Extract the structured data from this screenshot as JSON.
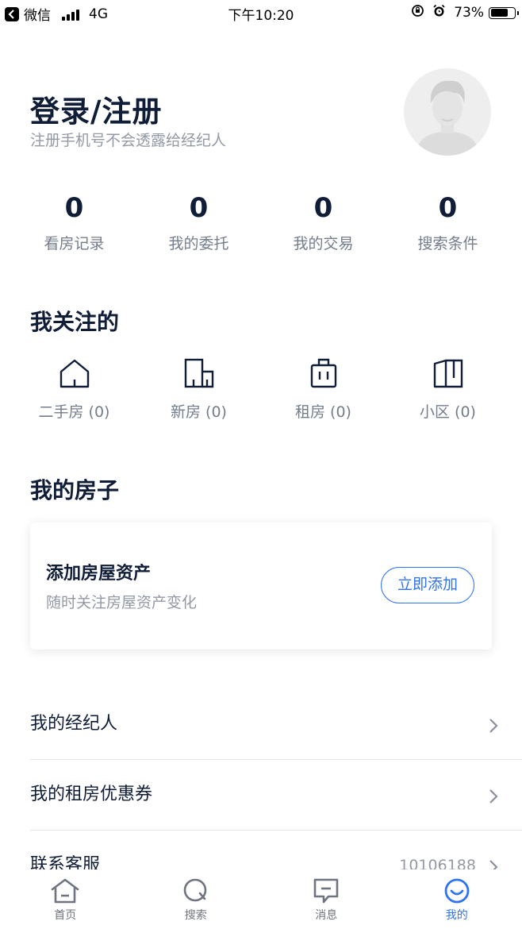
{
  "status_bar": {
    "back_app": "微信",
    "network": "4G",
    "time": "下午10:20",
    "battery": "73%",
    "battery_level": 0.73
  },
  "header": {
    "title": "登录/注册",
    "subtitle": "注册手机号不会透露给经纪人"
  },
  "stats": [
    {
      "value": "0",
      "label": "看房记录"
    },
    {
      "value": "0",
      "label": "我的委托"
    },
    {
      "value": "0",
      "label": "我的交易"
    },
    {
      "value": "0",
      "label": "搜索条件"
    }
  ],
  "follow_section": {
    "title": "我关注的",
    "items": [
      {
        "label": "二手房 (0)",
        "icon": "house-icon"
      },
      {
        "label": "新房 (0)",
        "icon": "building-icon"
      },
      {
        "label": "租房 (0)",
        "icon": "suitcase-icon"
      },
      {
        "label": "小区 (0)",
        "icon": "community-icon"
      }
    ]
  },
  "my_house": {
    "title": "我的房子",
    "card_title": "添加房屋资产",
    "card_subtitle": "随时关注房屋资产变化",
    "button": "立即添加"
  },
  "list": [
    {
      "label": "我的经纪人",
      "value": ""
    },
    {
      "label": "我的租房优惠券",
      "value": ""
    },
    {
      "label": "联系客服",
      "value": "10106188"
    }
  ],
  "tabs": [
    {
      "label": "首页",
      "icon": "home-icon",
      "active": false
    },
    {
      "label": "搜索",
      "icon": "search-icon",
      "active": false
    },
    {
      "label": "消息",
      "icon": "message-icon",
      "active": false
    },
    {
      "label": "我的",
      "icon": "profile-icon",
      "active": true
    }
  ],
  "colors": {
    "primary_text": "#101d37",
    "secondary_text": "#9399a5",
    "accent": "#3072f6"
  }
}
